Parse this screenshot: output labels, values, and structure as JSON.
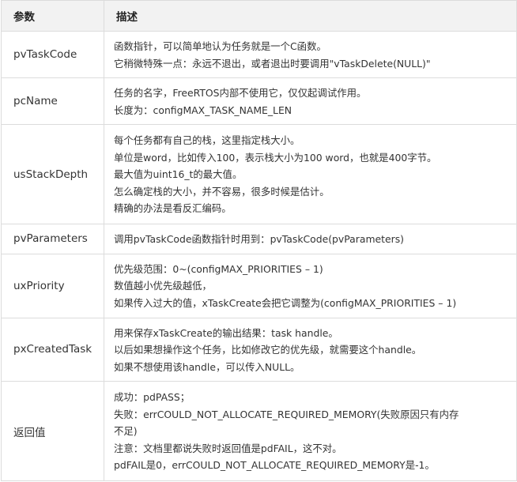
{
  "headers": {
    "param": "参数",
    "desc": "描述"
  },
  "rows": [
    {
      "name": "pvTaskCode",
      "lines": [
        "函数指针，可以简单地认为任务就是一个C函数。",
        "它稍微特殊一点：永远不退出，或者退出时要调用\"vTaskDelete(NULL)\""
      ]
    },
    {
      "name": "pcName",
      "lines": [
        "任务的名字，FreeRTOS内部不使用它，仅仅起调试作用。",
        "长度为：configMAX_TASK_NAME_LEN"
      ]
    },
    {
      "name": "usStackDepth",
      "lines": [
        "每个任务都有自己的栈，这里指定栈大小。",
        "单位是word，比如传入100，表示栈大小为100 word，也就是400字节。",
        "最大值为uint16_t的最大值。",
        "怎么确定栈的大小，并不容易，很多时候是估计。",
        "精确的办法是看反汇编码。"
      ]
    },
    {
      "name": "pvParameters",
      "lines": [
        "调用pvTaskCode函数指针时用到：pvTaskCode(pvParameters)"
      ]
    },
    {
      "name": "uxPriority",
      "lines": [
        "优先级范围：0~(configMAX_PRIORITIES – 1)",
        "数值越小优先级越低，",
        "如果传入过大的值，xTaskCreate会把它调整为(configMAX_PRIORITIES – 1)"
      ]
    },
    {
      "name": "pxCreatedTask",
      "lines": [
        "用来保存xTaskCreate的输出结果：task handle。",
        "以后如果想操作这个任务，比如修改它的优先级，就需要这个handle。",
        "如果不想使用该handle，可以传入NULL。"
      ]
    },
    {
      "name": "返回值",
      "lines": [
        "成功：pdPASS；",
        "失败：errCOULD_NOT_ALLOCATE_REQUIRED_MEMORY(失败原因只有内存",
        "不足)",
        "注意：文档里都说失败时返回值是pdFAIL，这不对。",
        "pdFAIL是0，errCOULD_NOT_ALLOCATE_REQUIRED_MEMORY是-1。"
      ]
    }
  ]
}
